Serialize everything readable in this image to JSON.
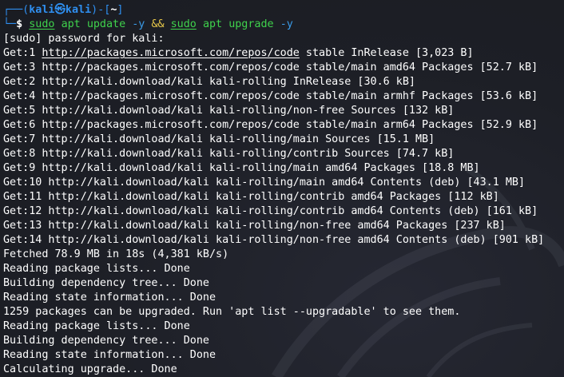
{
  "prompt": {
    "corner_top": "┌──(",
    "user": "kali",
    "at_symbol": "㉿",
    "host": "kali",
    "close_paren": ")-[",
    "dir": "~",
    "close_bracket": "]",
    "corner_bottom": "└─",
    "dollar": "$ "
  },
  "command": {
    "sudo1": "sudo",
    "apt1": "apt",
    "update": "update",
    "flag1": "-y",
    "and_op": "&&",
    "sudo2": "sudo",
    "apt2": "apt",
    "upgrade": "upgrade",
    "flag2": "-y"
  },
  "output": {
    "sudo_prompt": "[sudo] password for kali:",
    "get1_prefix": "Get:1 ",
    "get1_url": "http://packages.microsoft.com/repos/code",
    "get1_suffix": " stable InRelease [3,023 B]",
    "lines": [
      "Get:3 http://packages.microsoft.com/repos/code stable/main amd64 Packages [52.7 kB]",
      "Get:2 http://kali.download/kali kali-rolling InRelease [30.6 kB]",
      "Get:4 http://packages.microsoft.com/repos/code stable/main armhf Packages [53.6 kB]",
      "Get:5 http://kali.download/kali kali-rolling/non-free Sources [132 kB]",
      "Get:6 http://packages.microsoft.com/repos/code stable/main arm64 Packages [52.9 kB]",
      "Get:7 http://kali.download/kali kali-rolling/main Sources [15.1 MB]",
      "Get:8 http://kali.download/kali kali-rolling/contrib Sources [74.7 kB]",
      "Get:9 http://kali.download/kali kali-rolling/main amd64 Packages [18.8 MB]",
      "Get:10 http://kali.download/kali kali-rolling/main amd64 Contents (deb) [43.1 MB]",
      "Get:11 http://kali.download/kali kali-rolling/contrib amd64 Packages [112 kB]",
      "Get:12 http://kali.download/kali kali-rolling/contrib amd64 Contents (deb) [161 kB]",
      "Get:13 http://kali.download/kali kali-rolling/non-free amd64 Packages [237 kB]",
      "Get:14 http://kali.download/kali kali-rolling/non-free amd64 Contents (deb) [901 kB]",
      "Fetched 78.9 MB in 18s (4,381 kB/s)",
      "Reading package lists... Done",
      "Building dependency tree... Done",
      "Reading state information... Done",
      "1259 packages can be upgraded. Run 'apt list --upgradable' to see them.",
      "Reading package lists... Done",
      "Building dependency tree... Done",
      "Reading state information... Done",
      "Calculating upgrade... Done"
    ]
  },
  "colors": {
    "background": "#1d1f26",
    "prompt_blue": "#2f8ff0",
    "command_green": "#3fd24c",
    "flag_blue": "#3a9be8",
    "operator_yellow": "#e8c84a",
    "text": "#ffffff"
  },
  "icons": {
    "wallpaper": "kali-dragon-icon"
  }
}
